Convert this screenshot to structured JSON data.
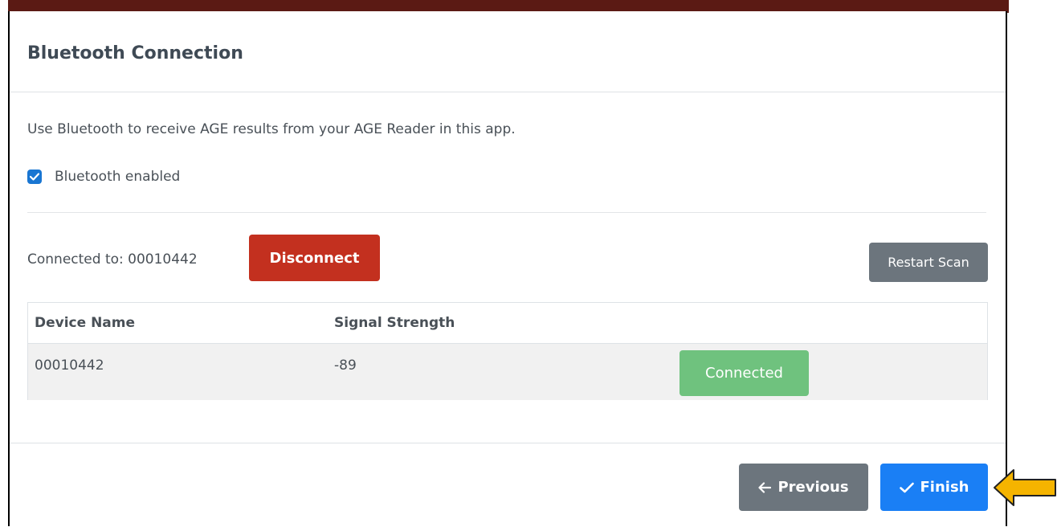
{
  "modal": {
    "title": "Bluetooth Connection"
  },
  "body": {
    "intro": "Use Bluetooth to receive AGE results from your AGE Reader in this app.",
    "bluetooth_enabled": {
      "label": "Bluetooth enabled",
      "checked": true
    },
    "connected_label": "Connected to: 00010442",
    "disconnect_label": "Disconnect",
    "restart_scan_label": "Restart Scan"
  },
  "table": {
    "headers": [
      "Device Name",
      "Signal Strength"
    ],
    "rows": [
      {
        "device_name": "00010442",
        "signal_strength": "-89",
        "status": "Connected"
      }
    ]
  },
  "footer": {
    "previous_label": "Previous",
    "finish_label": "Finish"
  },
  "colors": {
    "danger": "#c3301f",
    "secondary": "#6c757d",
    "success": "#6fc27e",
    "primary": "#1a7ff5",
    "pointer": "#f5b400"
  },
  "icons": {
    "previous": "arrow-left-icon",
    "finish": "checkmark-icon",
    "checkbox": "checkbox-icon",
    "pointer": "arrow-pointer-icon"
  }
}
